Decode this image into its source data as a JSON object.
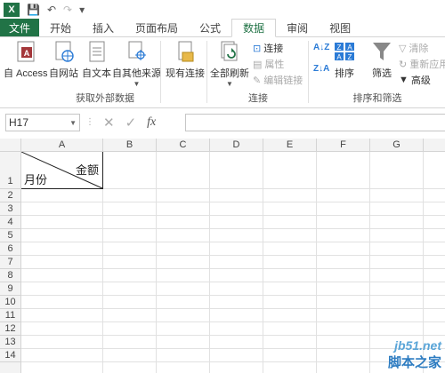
{
  "quick_access": {
    "app_icon": "X"
  },
  "tabs": [
    "文件",
    "开始",
    "插入",
    "页面布局",
    "公式",
    "数据",
    "审阅",
    "视图"
  ],
  "ribbon": {
    "external": {
      "label": "获取外部数据",
      "buttons": [
        "自 Access",
        "自网站",
        "自文本",
        "自其他来源",
        "现有连接"
      ]
    },
    "connections": {
      "label": "连接",
      "refresh_all": "全部刷新",
      "connections": "连接",
      "properties": "属性",
      "edit_links": "编辑链接"
    },
    "sort_filter": {
      "label": "排序和筛选",
      "sort": "排序",
      "filter": "筛选",
      "clear": "清除",
      "reapply": "重新应用",
      "advanced": "高级"
    }
  },
  "formula_bar": {
    "name_box": "H17",
    "fx": "fx",
    "value": ""
  },
  "sheet": {
    "columns": [
      "A",
      "B",
      "C",
      "D",
      "E",
      "F",
      "G"
    ],
    "rows": [
      "1",
      "2",
      "3",
      "4",
      "5",
      "6",
      "7",
      "8",
      "9",
      "10",
      "11",
      "12",
      "13",
      "14"
    ],
    "a1_top_right": "金额",
    "a1_bottom_left": "月份"
  },
  "watermark": {
    "site": "jb51.net",
    "name": "脚本之家"
  },
  "colors": {
    "accent": "#217346"
  }
}
